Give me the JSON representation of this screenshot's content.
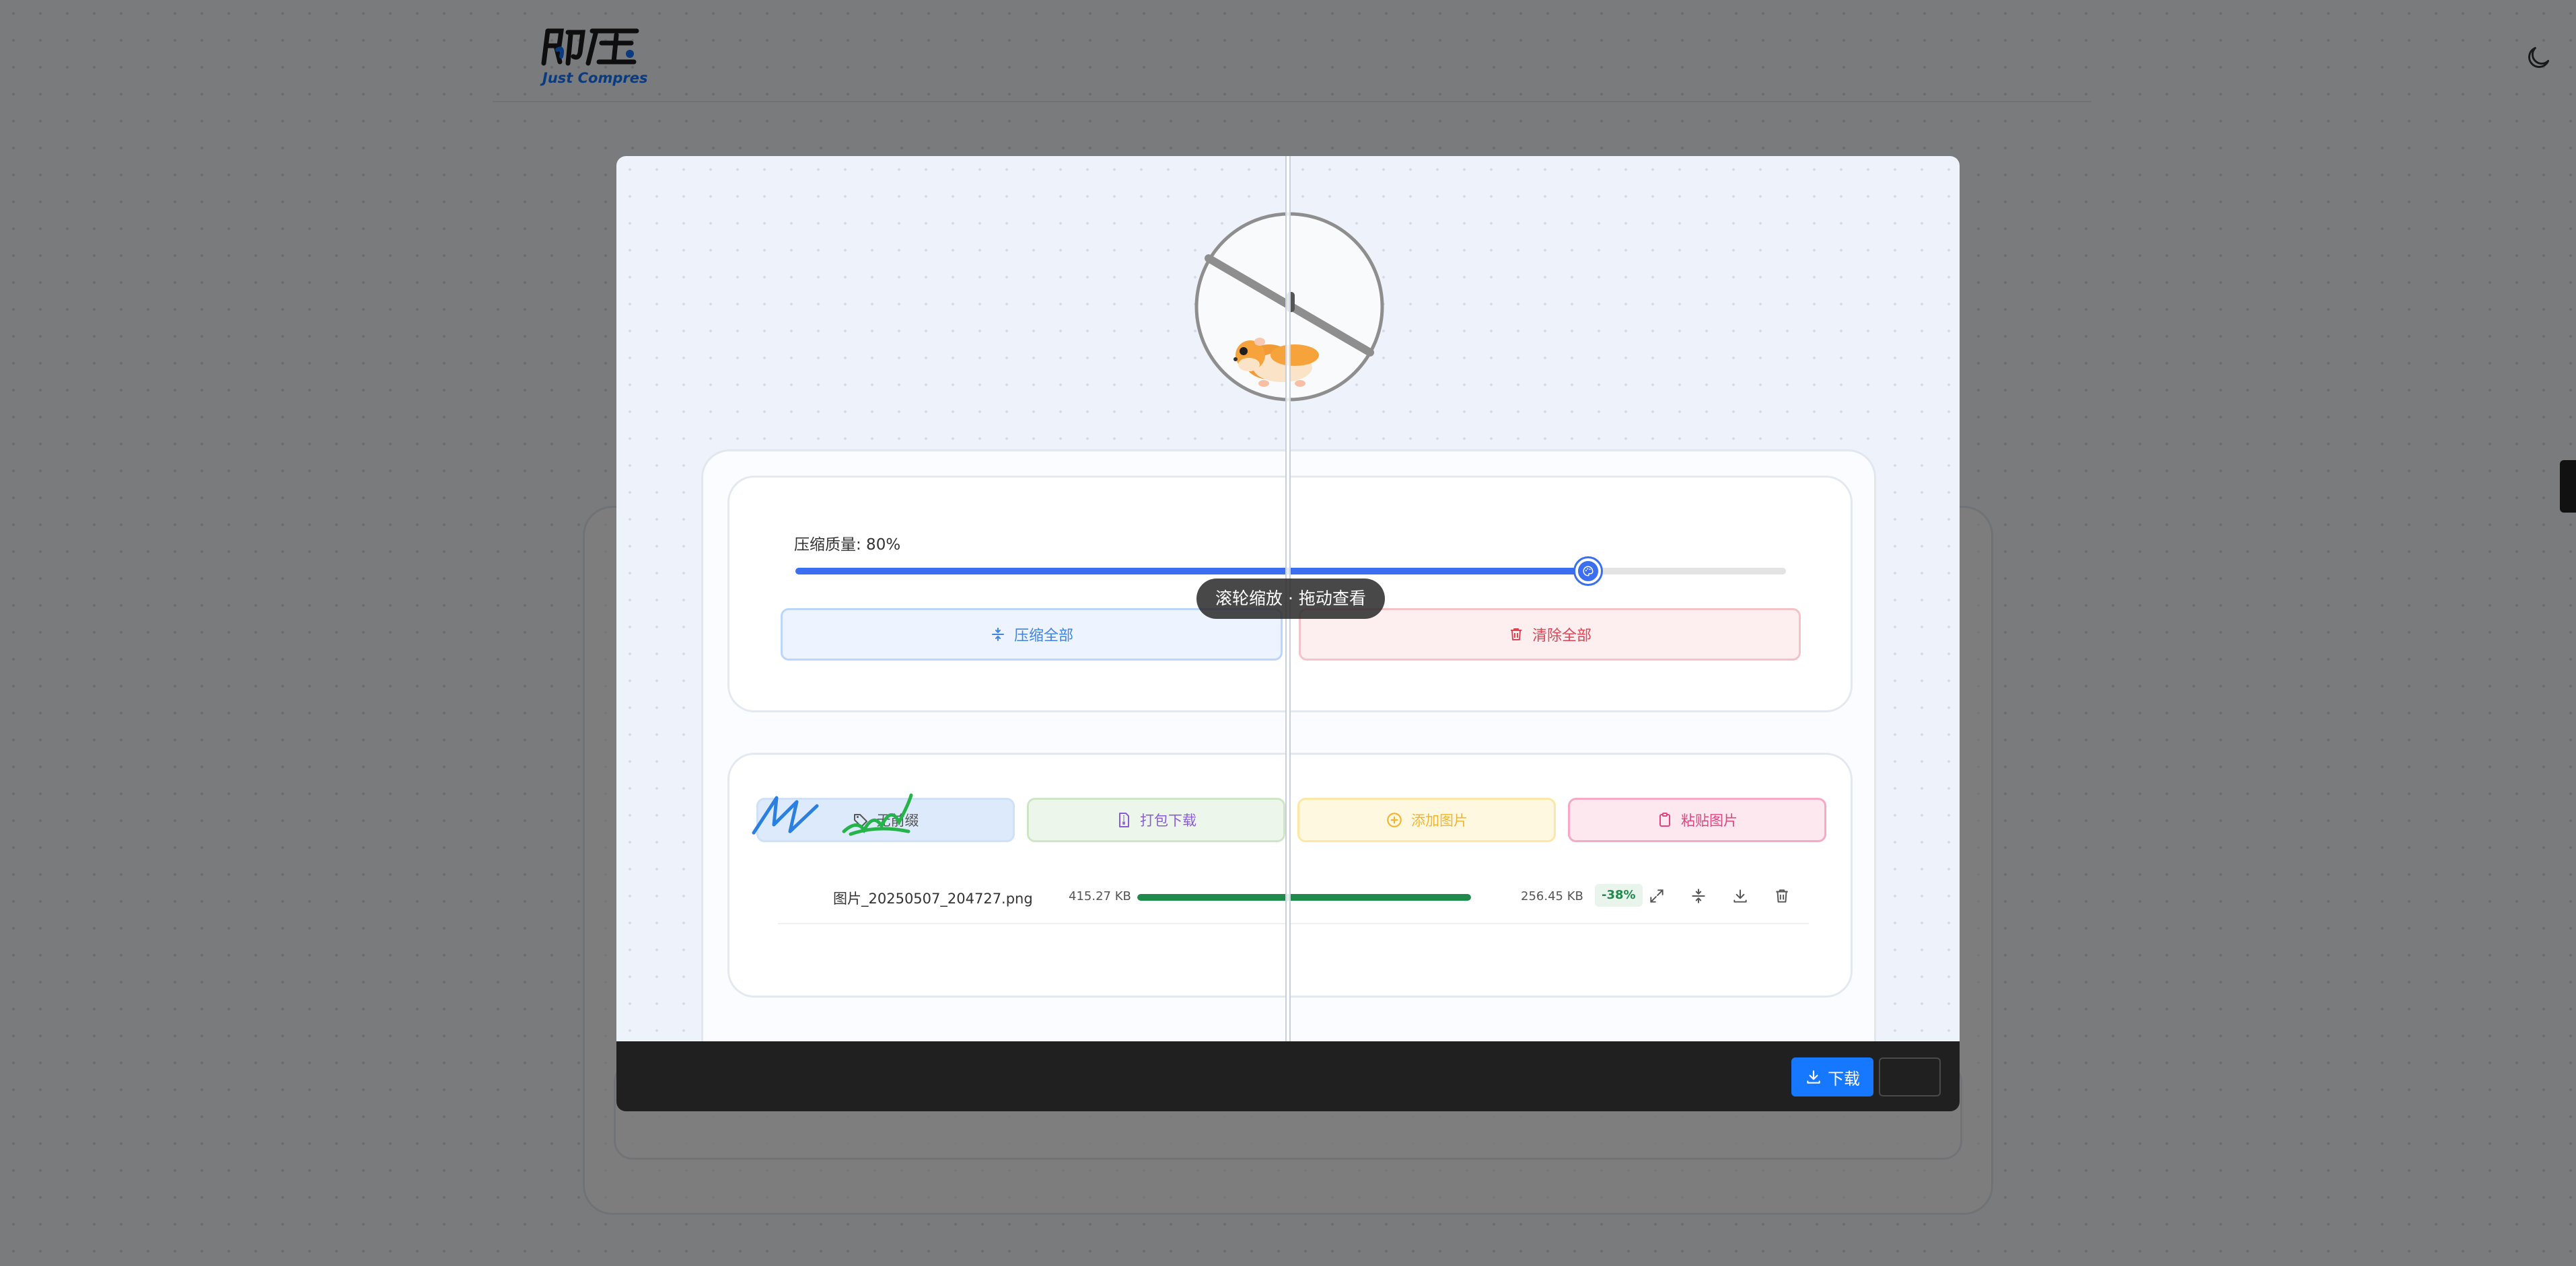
{
  "header": {
    "logo_text": "即压",
    "logo_subtitle": "Just Compres",
    "theme_toggle_icon": "moon-icon"
  },
  "quality": {
    "label": "压缩质量: 80%",
    "value": 80
  },
  "actions": {
    "compress_all": "压缩全部",
    "clear_all": "清除全部"
  },
  "toolbar": {
    "no_prefix": "无前缀",
    "zip_download": "打包下载",
    "add_image": "添加图片",
    "paste_image": "粘贴图片"
  },
  "files": [
    {
      "name": "图片_20250507_204727.png",
      "original_size": "415.27 KB",
      "progress": 1.0,
      "compressed_size": "256.45 KB",
      "ratio": "-38%"
    }
  ],
  "preview": {
    "hint": "滚轮缩放 · 拖动查看",
    "download_label": "下载"
  },
  "colors": {
    "accent": "#3b6ff0",
    "success": "#1f8a4c",
    "danger": "#e04453",
    "primary_button": "#1677ff"
  }
}
